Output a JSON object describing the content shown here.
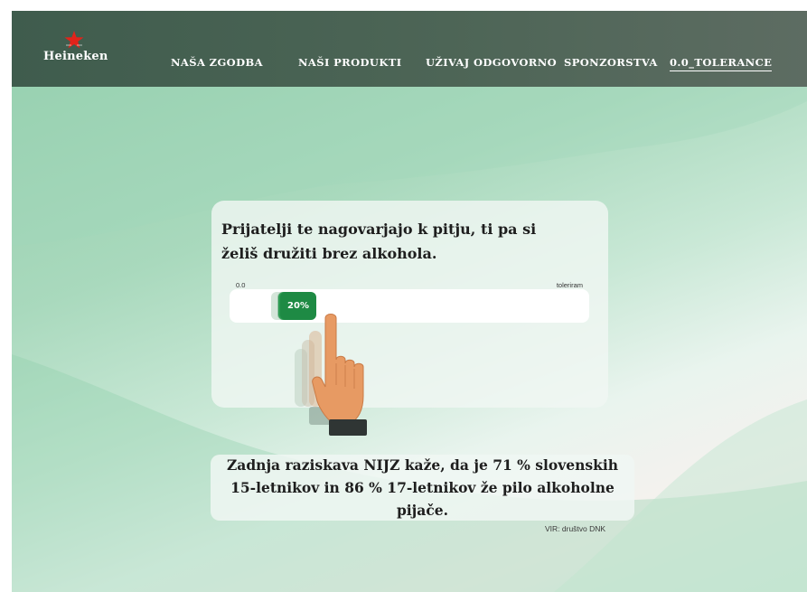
{
  "brand": {
    "name": "Heineken",
    "star_color": "#e2231a"
  },
  "nav": {
    "items": [
      {
        "label": "NAŠA ZGODBA"
      },
      {
        "label": "NAŠI PRODUKTI"
      },
      {
        "label": "UŽIVAJ ODGOVORNO"
      },
      {
        "label": "SPONZORSTVA"
      },
      {
        "label": "0.0_TOLERANCE",
        "active": true
      }
    ]
  },
  "quiz": {
    "question": "Prijatelji te nagovarjajo k pitju, ti pa si želiš družiti brez alkohola.",
    "scale_min": "0.0",
    "scale_max": "toleriram",
    "value_label": "20%",
    "value": 0.2,
    "accent": "#1e8a44"
  },
  "fact": {
    "text": "Zadnja raziskava NIJZ kaže, da je 71 % slovenskih 15-letnikov in 86 % 17-letnikov že pilo alkoholne pijače.",
    "source": "VIR: društvo DNK"
  },
  "icons": {
    "logo_star": "red-star-icon",
    "pointer": "pointing-hand-icon"
  }
}
